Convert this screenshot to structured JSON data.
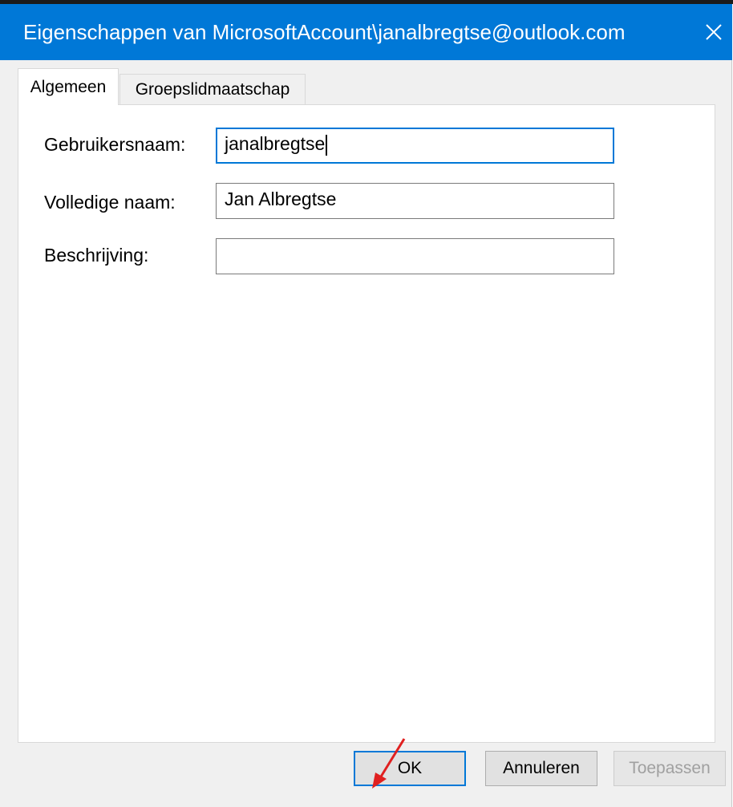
{
  "window": {
    "title": "Eigenschappen van MicrosoftAccount\\janalbregtse@outlook.com",
    "accent_color": "#0078d7",
    "close_icon": "close-icon"
  },
  "tabs": [
    {
      "label": "Algemeen",
      "active": true
    },
    {
      "label": "Groepslidmaatschap",
      "active": false
    }
  ],
  "form": {
    "username": {
      "label": "Gebruikersnaam:",
      "value": "janalbregtse"
    },
    "fullname": {
      "label": "Volledige naam:",
      "value": "Jan Albregtse"
    },
    "description": {
      "label": "Beschrijving:",
      "value": ""
    }
  },
  "buttons": {
    "ok": "OK",
    "cancel": "Annuleren",
    "apply": "Toepassen"
  },
  "annotation": {
    "arrow_color": "#e02020",
    "arrow_icon": "red-arrow-icon"
  }
}
